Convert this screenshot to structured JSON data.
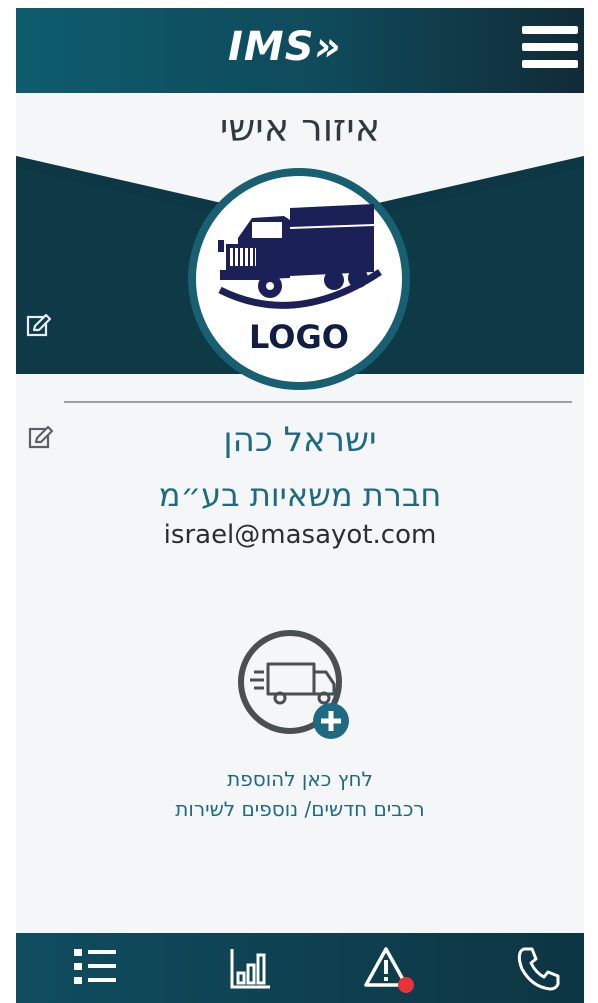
{
  "header": {
    "brand": "IMS",
    "brand_chevrons": "»",
    "menu_icon": "hamburger-menu-icon"
  },
  "page": {
    "title": "איזור אישי"
  },
  "profile": {
    "logo_label": "LOGO",
    "name": "ישראל כהן",
    "company": "חברת משאיות בע״מ",
    "email": "israel@masayot.com"
  },
  "add_vehicle": {
    "line1": "לחץ כאן להוספת",
    "line2": "רכבים חדשים/ נוספים לשירות"
  },
  "bottom_nav": {
    "items": [
      "list-icon",
      "bar-chart-icon",
      "alert-icon",
      "phone-icon"
    ],
    "alert_badge_color": "#e8323c"
  },
  "colors": {
    "header_from": "#0d5c6e",
    "header_to": "#112b37",
    "accent": "#1e6a82",
    "banner": "#0e3a47"
  }
}
